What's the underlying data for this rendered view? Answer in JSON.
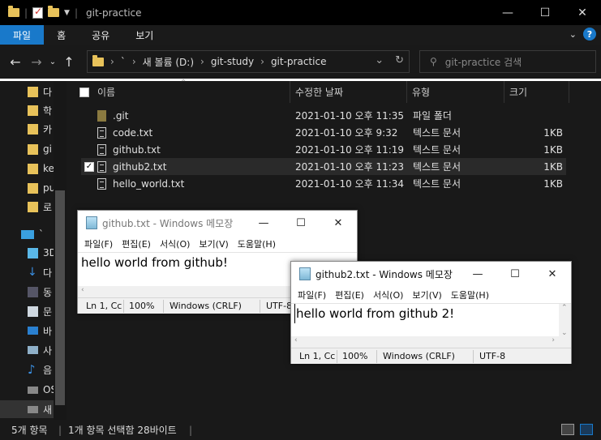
{
  "explorer": {
    "title": "git-practice",
    "window_controls": {
      "minimize": "—",
      "maximize": "☐",
      "close": "✕"
    },
    "ribbon_tabs": [
      "파일",
      "홈",
      "공유",
      "보기"
    ],
    "active_tab": "파일",
    "address": {
      "prefix": "`",
      "crumbs": [
        "새 볼륨 (D:)",
        "git-study",
        "git-practice"
      ]
    },
    "search_placeholder": "git-practice 검색",
    "sidebar": [
      {
        "label": "다",
        "icon": "folder-icon"
      },
      {
        "label": "학",
        "icon": "folder-icon"
      },
      {
        "label": "카",
        "icon": "folder-icon"
      },
      {
        "label": "gi",
        "icon": "folder-icon"
      },
      {
        "label": "ke",
        "icon": "folder-icon"
      },
      {
        "label": "pu",
        "icon": "folder-icon"
      },
      {
        "label": "로",
        "icon": "folder-icon"
      },
      {
        "label": "`",
        "icon": "pc-icon"
      },
      {
        "label": "3D",
        "icon": "3d-objects-icon"
      },
      {
        "label": "다",
        "icon": "download-icon"
      },
      {
        "label": "동",
        "icon": "video-icon"
      },
      {
        "label": "문",
        "icon": "document-icon"
      },
      {
        "label": "바",
        "icon": "desktop-icon"
      },
      {
        "label": "사",
        "icon": "picture-icon"
      },
      {
        "label": "음",
        "icon": "music-icon"
      },
      {
        "label": "OS",
        "icon": "drive-icon"
      },
      {
        "label": "새",
        "icon": "drive-icon"
      }
    ],
    "columns": [
      "이름",
      "수정한 날짜",
      "유형",
      "크기"
    ],
    "files": [
      {
        "name": ".git",
        "date": "2021-01-10 오후 11:35",
        "type": "파일 폴더",
        "size": "",
        "kind": "folder"
      },
      {
        "name": "code.txt",
        "date": "2021-01-10 오후 9:32",
        "type": "텍스트 문서",
        "size": "1KB",
        "kind": "text"
      },
      {
        "name": "github.txt",
        "date": "2021-01-10 오후 11:19",
        "type": "텍스트 문서",
        "size": "1KB",
        "kind": "text"
      },
      {
        "name": "github2.txt",
        "date": "2021-01-10 오후 11:23",
        "type": "텍스트 문서",
        "size": "1KB",
        "kind": "text",
        "selected": true
      },
      {
        "name": "hello_world.txt",
        "date": "2021-01-10 오후 11:34",
        "type": "텍스트 문서",
        "size": "1KB",
        "kind": "text"
      }
    ],
    "status": {
      "count": "5개 항목",
      "selection": "1개 항목 선택함 28바이트"
    }
  },
  "notepad1": {
    "title": "github.txt - Windows 메모장",
    "menu": [
      "파일(F)",
      "편집(E)",
      "서식(O)",
      "보기(V)",
      "도움말(H)"
    ],
    "content": "hello world from github!",
    "status": {
      "position": "Ln 1, Cc",
      "zoom": "100%",
      "eol": "Windows (CRLF)",
      "encoding": "UTF-8"
    }
  },
  "notepad2": {
    "title": "github2.txt - Windows 메모장",
    "menu": [
      "파일(F)",
      "편집(E)",
      "서식(O)",
      "보기(V)",
      "도움말(H)"
    ],
    "content": "hello world from github 2!",
    "status": {
      "position": "Ln 1, Cc",
      "zoom": "100%",
      "eol": "Windows (CRLF)",
      "encoding": "UTF-8"
    }
  }
}
